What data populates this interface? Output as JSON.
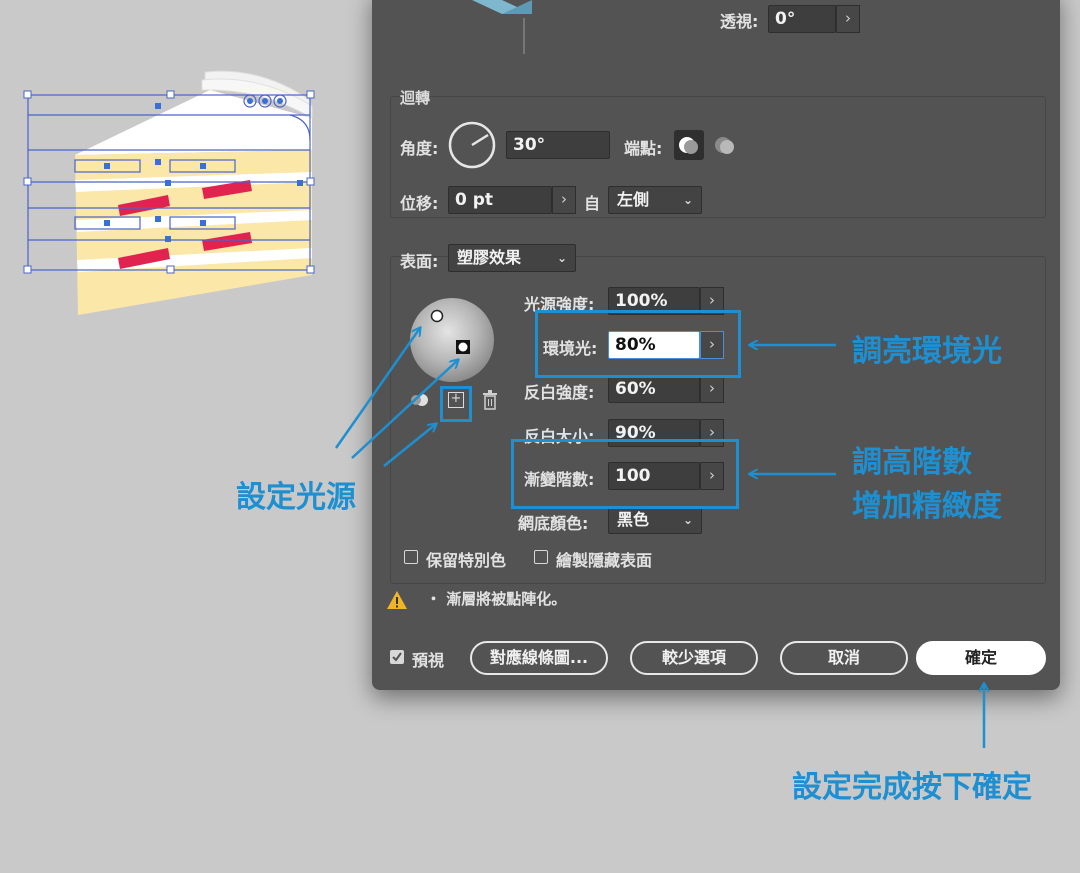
{
  "dialog": {
    "perspective": {
      "label": "透視:",
      "value": "0°"
    },
    "revolve": {
      "title": "迴轉",
      "angle_label": "角度:",
      "angle_value": "30°",
      "cap_label": "端點:",
      "offset_label": "位移:",
      "offset_value": "0 pt",
      "from_label": "自",
      "from_value": "左側"
    },
    "surface": {
      "label": "表面:",
      "value": "塑膠效果",
      "light_intensity_label": "光源強度:",
      "light_intensity_value": "100%",
      "ambient_label": "環境光:",
      "ambient_value": "80%",
      "highlight_intensity_label": "反白強度:",
      "highlight_intensity_value": "60%",
      "highlight_size_label": "反白大小:",
      "highlight_size_value": "90%",
      "blend_steps_label": "漸變階數:",
      "blend_steps_value": "100",
      "shading_color_label": "網底顏色:",
      "shading_color_value": "黑色",
      "preserve_spot_label": "保留特別色",
      "draw_hidden_label": "繪製隱藏表面"
    },
    "warning_text": "・ 漸層將被點陣化。",
    "buttons": {
      "preview_label": "預視",
      "map_art_label": "對應線條圖...",
      "fewer_options_label": "較少選項",
      "cancel_label": "取消",
      "ok_label": "確定"
    }
  },
  "annotations": {
    "brighten_ambient": "調亮環境光",
    "raise_steps_line1": "調高階數",
    "raise_steps_line2": "增加精緻度",
    "set_light": "設定光源",
    "confirm": "設定完成按下確定"
  },
  "colors": {
    "dialog_bg": "#535353",
    "accent": "#1e8fd0",
    "page_bg": "#c9c9c9"
  }
}
